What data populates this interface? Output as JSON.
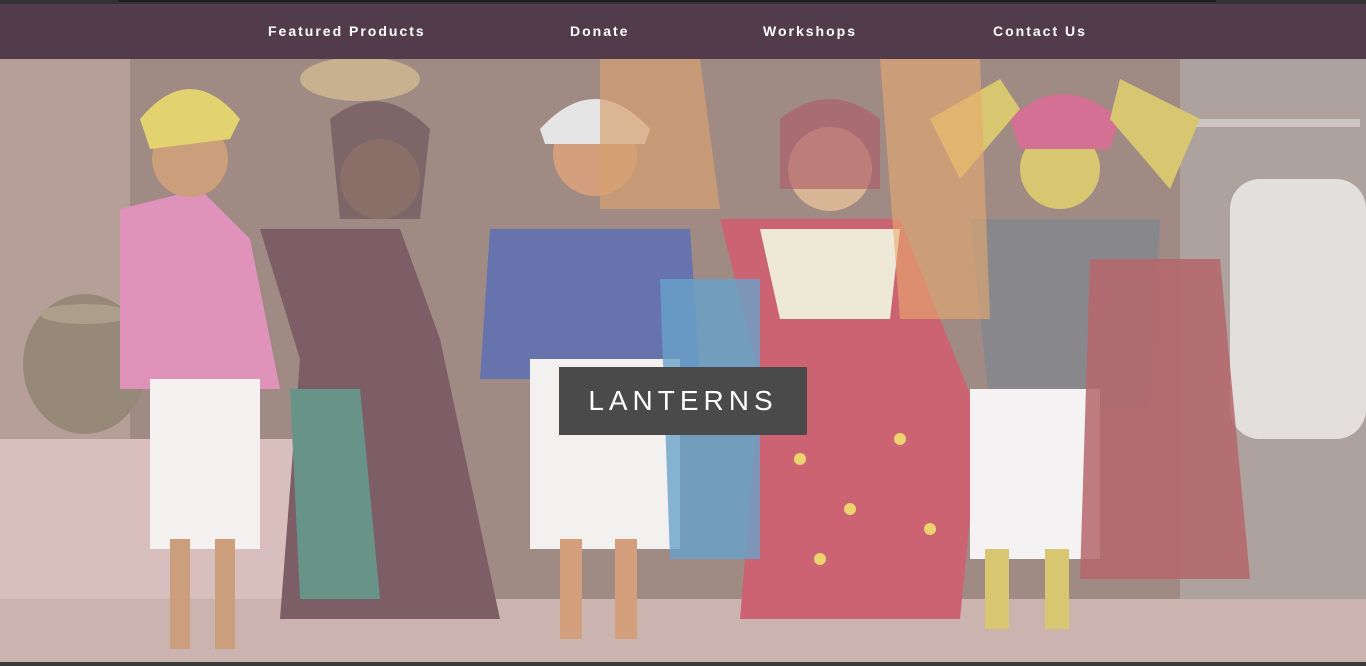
{
  "nav": {
    "featured_products": "Featured Products",
    "donate": "Donate",
    "workshops": "Workshops",
    "contact_us": "Contact Us"
  },
  "hero": {
    "brand": "LANTERNS",
    "image_subject": "row of handmade cloth dolls in colorful traditional dress"
  },
  "colors": {
    "nav_background": "#523c4b",
    "brand_box_background": "#4a4a4a",
    "nav_text": "#ffffff"
  }
}
